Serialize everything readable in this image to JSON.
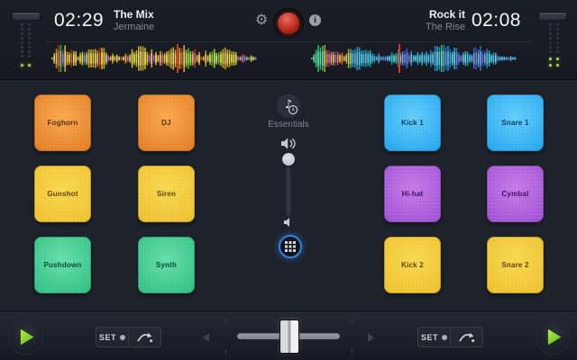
{
  "deck_a": {
    "time": "02:29",
    "title": "The Mix",
    "artist": "Jermaine",
    "waveform_playhead": 0.61,
    "waveform_palette": "yellow-multicolor"
  },
  "deck_b": {
    "time": "02:08",
    "title": "Rock it",
    "artist": "The Rise",
    "waveform_playhead": 0.42,
    "waveform_palette": "blue-multicolor"
  },
  "header": {
    "icons": {
      "gear": "⚙",
      "info": "i",
      "record": "record-dot"
    }
  },
  "sample_browser": {
    "pack_label": "Essentials",
    "badge_arrow": "↓"
  },
  "pads": {
    "left": [
      {
        "label": "Foghorn",
        "color": "orange"
      },
      {
        "label": "DJ",
        "color": "orange"
      },
      {
        "label": "Gunshot",
        "color": "yellow"
      },
      {
        "label": "Siren",
        "color": "yellow"
      },
      {
        "label": "Pushdown",
        "color": "green"
      },
      {
        "label": "Synth",
        "color": "green"
      }
    ],
    "right": [
      {
        "label": "Kick 1",
        "color": "blue"
      },
      {
        "label": "Snare 1",
        "color": "blue"
      },
      {
        "label": "Hi-hat",
        "color": "purple"
      },
      {
        "label": "Cymbal",
        "color": "purple"
      },
      {
        "label": "Kick 2",
        "color": "yellow"
      },
      {
        "label": "Snare 2",
        "color": "yellow"
      }
    ]
  },
  "pad_colors": {
    "orange": {
      "light": "#f9a84e",
      "dark": "#e07a20",
      "text": "#5a3008"
    },
    "yellow": {
      "light": "#f8d84e",
      "dark": "#edbf2b",
      "text": "#5c4505"
    },
    "green": {
      "light": "#63dfa9",
      "dark": "#2dbd80",
      "text": "#0d4a30"
    },
    "blue": {
      "light": "#62cdfa",
      "dark": "#20a3ee",
      "text": "#083c5c"
    },
    "purple": {
      "light": "#c57ae6",
      "dark": "#9c4ed2",
      "text": "#3c1160"
    }
  },
  "transport": {
    "set_label": "SET"
  },
  "colors": {
    "accent_blue": "#2e7fe0",
    "play_green": "#7ed321",
    "playhead_red": "#d8382c",
    "led_green": "#a6d94b",
    "record_red": "#c6251a",
    "background": "#1e222b",
    "topbar": "#181c22"
  }
}
